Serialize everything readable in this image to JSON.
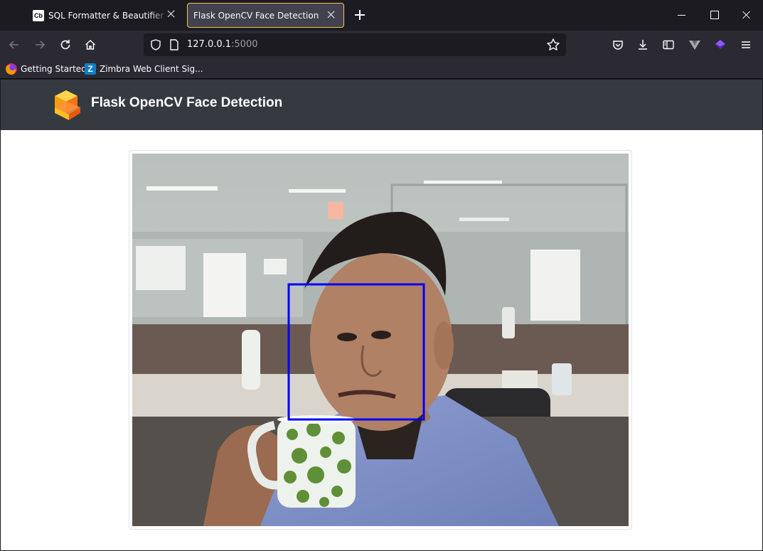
{
  "browser": {
    "tabs": [
      {
        "favicon_text": "Cb",
        "title": "SQL Formatter & Beautifier Online",
        "active": false
      },
      {
        "title": "Flask OpenCV Face Detection",
        "active": true
      }
    ],
    "url": {
      "host": "127.0.0.1",
      "port": ":5000"
    },
    "bookmarks": [
      {
        "label": "Getting Started",
        "icon": "firefox-icon"
      },
      {
        "label": "Zimbra Web Client Sig...",
        "icon": "zimbra-icon",
        "icon_text": "Z"
      }
    ],
    "toolbar_icons": [
      "back-icon",
      "forward-icon",
      "reload-icon",
      "home-icon",
      "pocket-icon",
      "downloads-icon",
      "sidebar-icon",
      "vuejs-devtools-icon",
      "extension-icon",
      "menu-icon"
    ]
  },
  "page": {
    "header": {
      "title": "Flask OpenCV Face Detection",
      "logo": "stacked-cubes-logo"
    },
    "video_feed": {
      "description_icon": "webcam-stream",
      "detection_box_color": "#0000ff"
    }
  },
  "colors": {
    "tab_accent": "#f2c94c",
    "header_bg": "#343a40",
    "browser_bg": "#1c1b22",
    "toolbar_bg": "#2b2a33"
  }
}
